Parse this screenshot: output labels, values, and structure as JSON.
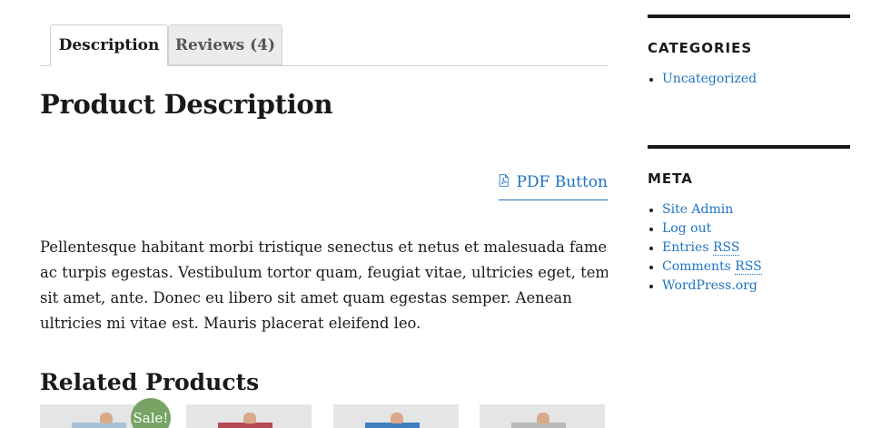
{
  "tabs": {
    "description": "Description",
    "reviews": "Reviews (4)"
  },
  "product": {
    "heading": "Product Description",
    "pdf_button": "PDF Button",
    "description_lines": [
      "Pellentesque habitant morbi tristique senectus et netus et malesuada fames",
      "ac turpis egestas. Vestibulum tortor quam, feugiat vitae, ultricies eget, tempor",
      "sit amet, ante. Donec eu libero sit amet quam egestas semper. Aenean",
      "ultricies mi vitae est. Mauris placerat eleifend leo."
    ]
  },
  "related": {
    "heading": "Related Products",
    "sale_badge": "Sale!",
    "products": [
      {
        "poster_color": "#a7c2d8",
        "on_sale": true
      },
      {
        "poster_color": "#b34a56",
        "on_sale": false
      },
      {
        "poster_color": "#3f7fbf",
        "on_sale": false
      },
      {
        "poster_color": "#b9b9b9",
        "on_sale": false
      }
    ]
  },
  "sidebar": {
    "categories": {
      "title": "Categories",
      "items": [
        "Uncategorized"
      ]
    },
    "meta": {
      "title": "Meta",
      "items": {
        "site_admin": "Site Admin",
        "log_out": "Log out",
        "entries_prefix": "Entries ",
        "entries_abbr": "RSS",
        "comments_prefix": "Comments ",
        "comments_abbr": "RSS",
        "wordpress": "WordPress.org"
      }
    }
  },
  "colors": {
    "link": "#1e73be",
    "text": "#1a1a1a",
    "sale_badge": "#77a464",
    "tab_inactive_bg": "#ebebeb"
  },
  "icons": {
    "pdf": "pdf-icon"
  }
}
